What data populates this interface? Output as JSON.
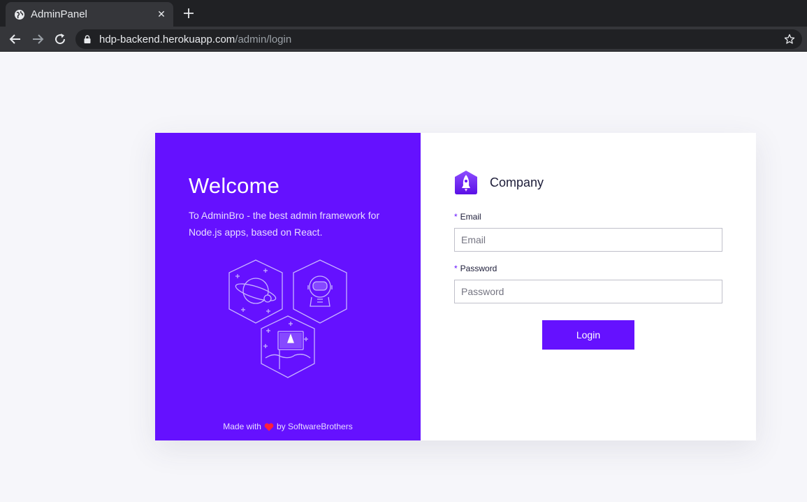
{
  "browser": {
    "tab_title": "AdminPanel",
    "url_domain": "hdp-backend.herokuapp.com",
    "url_path": "/admin/login",
    "icons": [
      "globe-icon",
      "close-icon",
      "plus-icon",
      "back-arrow-icon",
      "forward-arrow-icon",
      "reload-icon",
      "lock-icon",
      "star-icon"
    ]
  },
  "welcome": {
    "title": "Welcome",
    "description": "To AdminBro - the best admin framework for Node.js apps, based on React.",
    "footer_prefix": "Made with",
    "footer_by": "by",
    "footer_company": "SoftwareBrothers"
  },
  "form": {
    "company": "Company",
    "required_mark": "*",
    "email_label": "Email",
    "email_placeholder": "Email",
    "email_value": "",
    "password_label": "Password",
    "password_placeholder": "Password",
    "password_value": "",
    "login_label": "Login"
  },
  "colors": {
    "brand": "#6511ff",
    "page_bg": "#f6f6fa",
    "heart": "#ff1f3d"
  }
}
